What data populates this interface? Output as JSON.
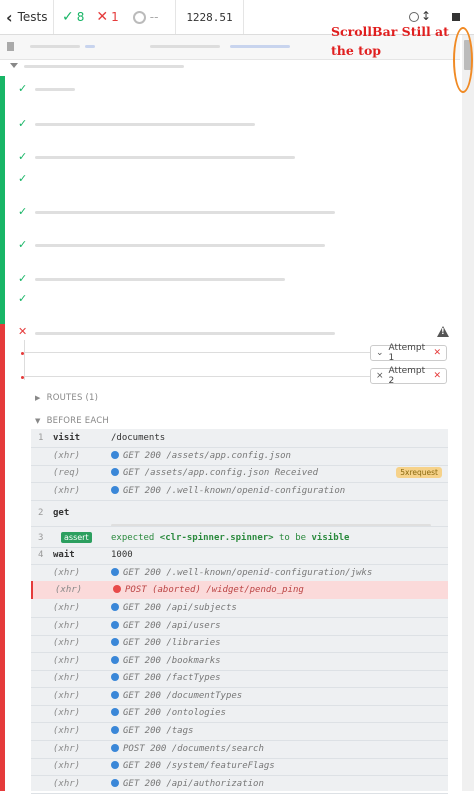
{
  "topbar": {
    "back_label": "Tests",
    "passed": "8",
    "failed": "1",
    "pending": "--",
    "duration": "1228.51"
  },
  "annotation": {
    "text": "ScrollBar Still at the top",
    "color": "#e01f1f",
    "oval_color": "#f08a24"
  },
  "colors": {
    "pass": "#18b566",
    "fail": "#e53b3b",
    "xhr_dot": "#3a87d8"
  },
  "attempts": [
    {
      "label": "Attempt 1",
      "icon": "chevron-down-icon"
    },
    {
      "label": "Attempt 2",
      "icon": "collapse-icon"
    }
  ],
  "sections": {
    "routes": "ROUTES (1)",
    "before_each": "BEFORE EACH"
  },
  "commands": [
    {
      "num": "1",
      "name": "visit",
      "msg": "/documents"
    },
    {
      "num": "",
      "name": "(xhr)",
      "msg": "GET 200 /assets/app.config.json"
    },
    {
      "num": "",
      "name": "(req)",
      "msg": "GET /assets/app.config.json Received",
      "tag": "5xrequest"
    },
    {
      "num": "",
      "name": "(xhr)",
      "msg": "GET 200 /.well-known/openid-configuration"
    },
    {
      "num": "2",
      "name": "get",
      "msg": ""
    },
    {
      "num": "3",
      "name": "assert",
      "msg_parts": [
        "expected",
        "<clr-spinner.spinner>",
        "to be",
        "visible"
      ]
    },
    {
      "num": "4",
      "name": "wait",
      "msg": "1000"
    },
    {
      "num": "",
      "name": "(xhr)",
      "msg": "GET 200 /.well-known/openid-configuration/jwks"
    },
    {
      "num": "",
      "name": "(xhr)",
      "msg": "POST (aborted) /widget/pendo_ping",
      "failed": true
    },
    {
      "num": "",
      "name": "(xhr)",
      "msg": "GET 200 /api/subjects"
    },
    {
      "num": "",
      "name": "(xhr)",
      "msg": "GET 200 /api/users"
    },
    {
      "num": "",
      "name": "(xhr)",
      "msg": "GET 200 /libraries"
    },
    {
      "num": "",
      "name": "(xhr)",
      "msg": "GET 200 /bookmarks"
    },
    {
      "num": "",
      "name": "(xhr)",
      "msg": "GET 200 /factTypes"
    },
    {
      "num": "",
      "name": "(xhr)",
      "msg": "GET 200 /documentTypes"
    },
    {
      "num": "",
      "name": "(xhr)",
      "msg": "GET 200 /ontologies"
    },
    {
      "num": "",
      "name": "(xhr)",
      "msg": "GET 200 /tags"
    },
    {
      "num": "",
      "name": "(xhr)",
      "msg": "POST 200 /documents/search"
    },
    {
      "num": "",
      "name": "(xhr)",
      "msg": "GET 200 /system/featureFlags"
    },
    {
      "num": "",
      "name": "(xhr)",
      "msg": "GET 200 /api/authorization"
    }
  ]
}
